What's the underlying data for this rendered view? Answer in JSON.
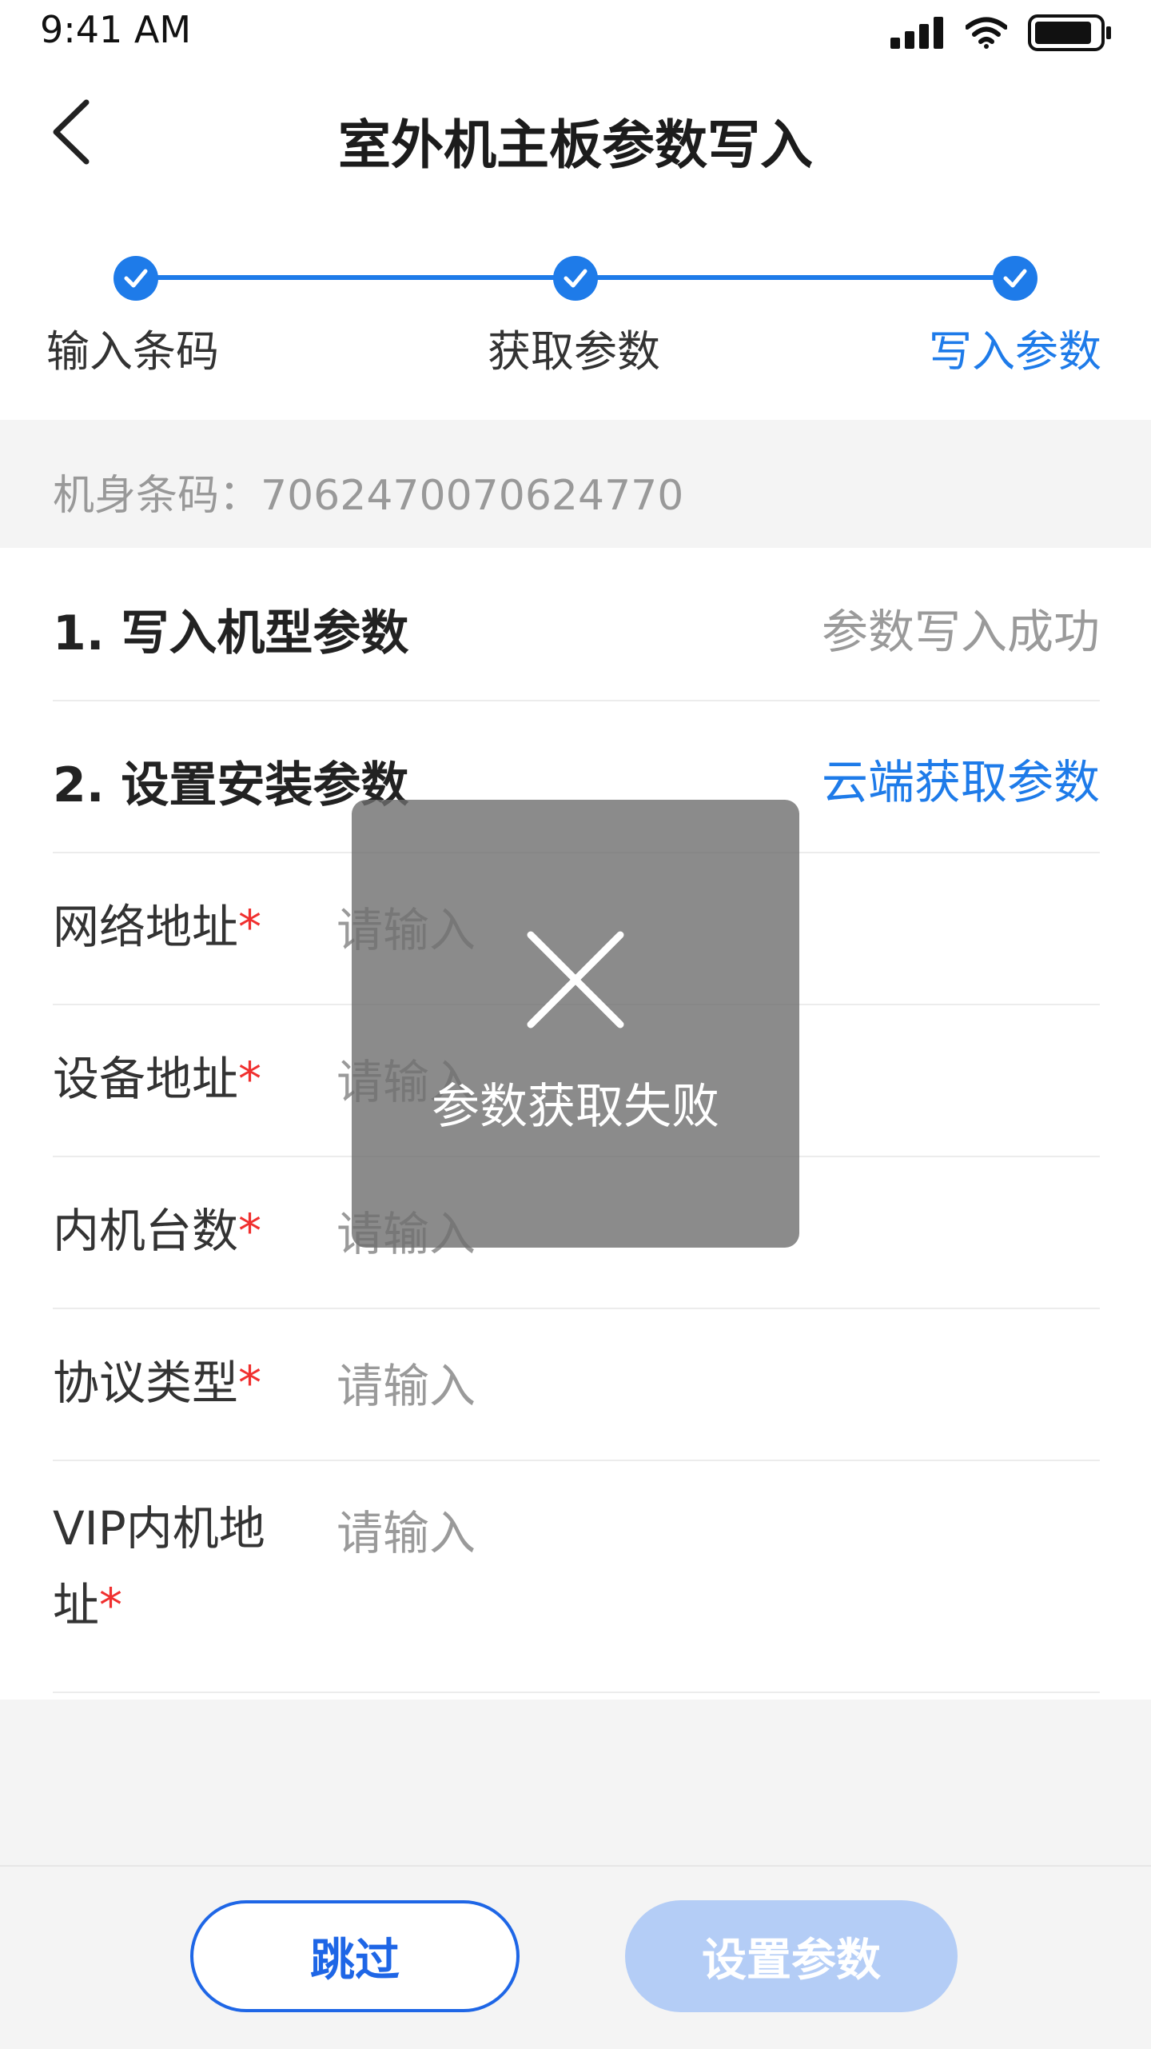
{
  "status_bar": {
    "time": "9:41 AM"
  },
  "header": {
    "title": "室外机主板参数写入"
  },
  "stepper": {
    "steps": [
      {
        "label": "输入条码"
      },
      {
        "label": "获取参数"
      },
      {
        "label": "写入参数"
      }
    ],
    "active_color": "#1e7be9"
  },
  "barcode": {
    "text": "机身条码：7062470070624770"
  },
  "sections": [
    {
      "title": "1. 写入机型参数",
      "status": "参数写入成功"
    },
    {
      "title": "2. 设置安装参数",
      "action": "云端获取参数"
    }
  ],
  "fields": [
    {
      "label": "网络地址",
      "placeholder": "请输入",
      "required": "*"
    },
    {
      "label": "设备地址",
      "placeholder": "请输入",
      "required": "*"
    },
    {
      "label": "内机台数",
      "placeholder": "请输入",
      "required": "*"
    },
    {
      "label": "协议类型",
      "placeholder": "请输入",
      "required": "*"
    },
    {
      "label_line1": "VIP内机地",
      "label_line2": "址",
      "placeholder": "请输入",
      "required": "*"
    }
  ],
  "toast": {
    "message": "参数获取失败",
    "icon": "close-icon"
  },
  "buttons": {
    "skip": "跳过",
    "set_params": "设置参数"
  },
  "colors": {
    "primary": "#1e7be9",
    "required": "#f0302f",
    "button_disabled": "#b4cdf6"
  }
}
